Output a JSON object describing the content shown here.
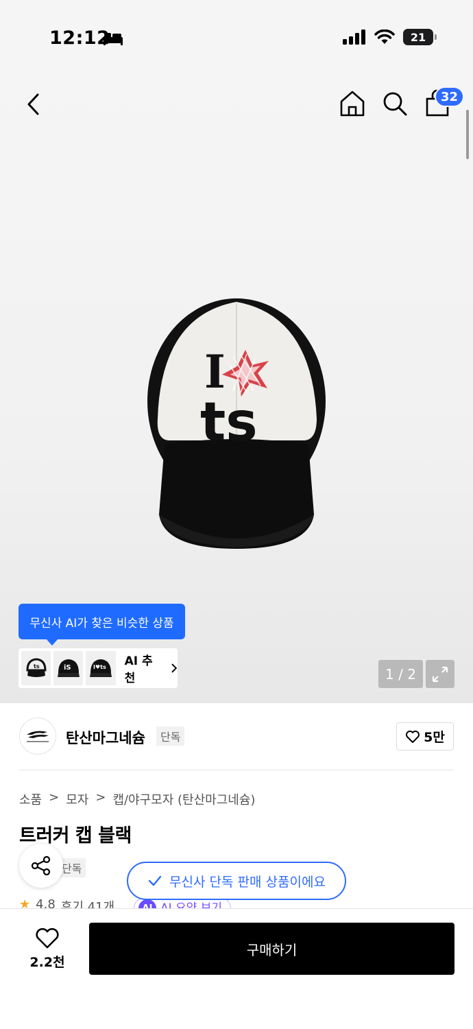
{
  "status_bar": {
    "time": "12:12",
    "battery": "21"
  },
  "nav": {
    "cart_count": "32"
  },
  "gallery": {
    "page_counter": "1 / 2"
  },
  "ai": {
    "tooltip": "무신사 AI가 찾은 비슷한 상품",
    "recommend_label": "AI 추천"
  },
  "brand": {
    "name": "탄산마그네슘",
    "exclusive_tag": "단독",
    "likes": "5만"
  },
  "breadcrumb": [
    "소품",
    "모자",
    "캡/야구모자 (탄산마그네슘)"
  ],
  "product": {
    "title": "트러커 캡 블랙",
    "exclusive_tag": "단독",
    "exclusive_notice": "무신사 단독 판매 상품이에요",
    "rating": "4.8",
    "reviews": "후기 41개",
    "ai_summary_badge": "AI",
    "ai_summary": "AI 요약 보기"
  },
  "bottom": {
    "wish_count": "2.2천",
    "buy_label": "구매하기"
  },
  "colors": {
    "accent": "#2f6bff",
    "buy_bg": "#000000",
    "ai_purple": "#6b4dff"
  }
}
